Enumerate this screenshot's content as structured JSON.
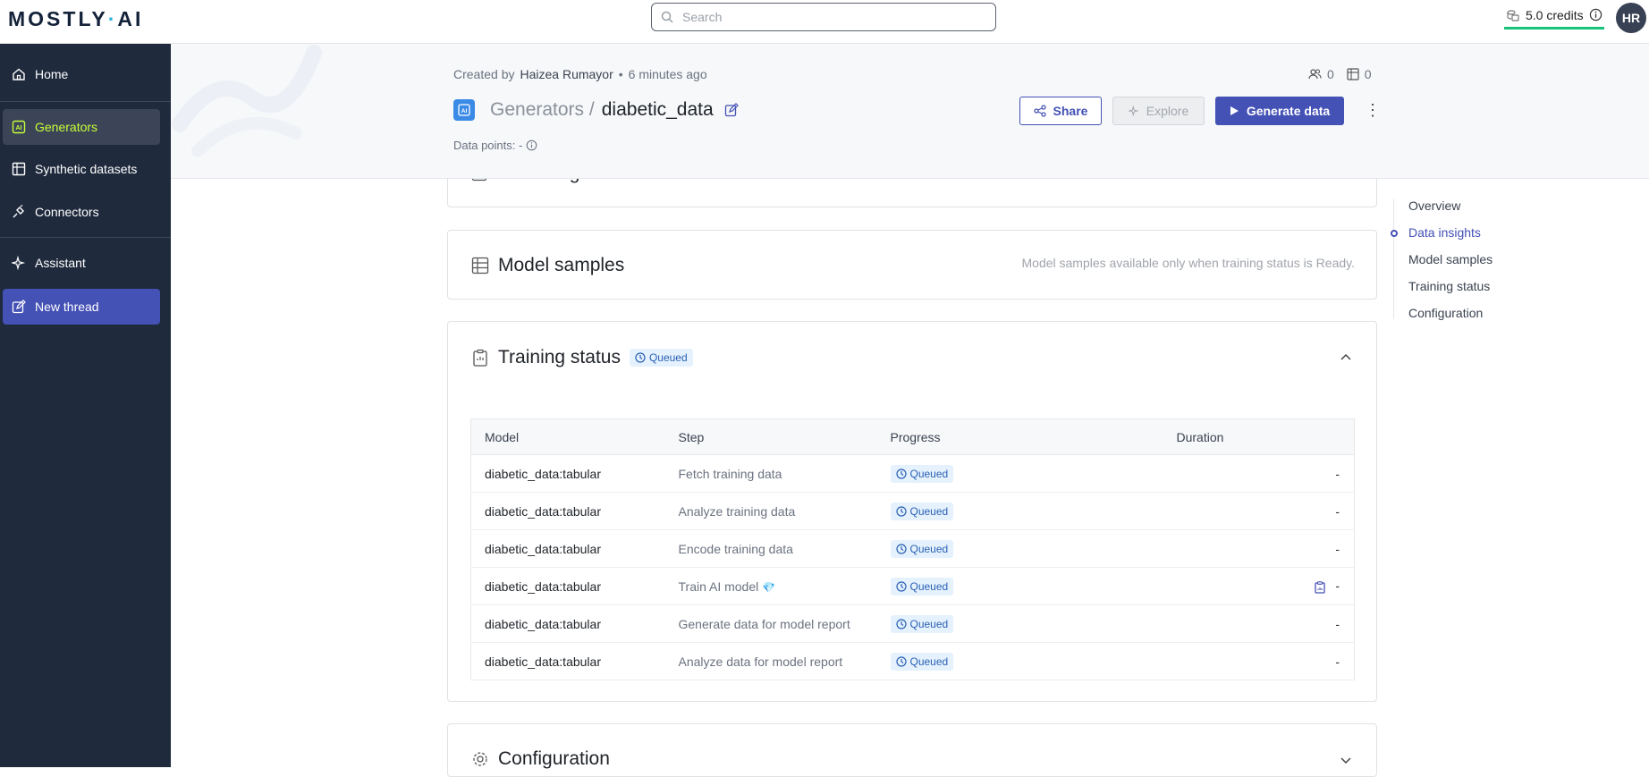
{
  "app": {
    "logo_left": "MOSTLY",
    "logo_dot": "·",
    "logo_right": "AI",
    "search_placeholder": "Search",
    "credits": "5.0 credits",
    "avatar_initials": "HR"
  },
  "sidebar": {
    "items": [
      {
        "label": "Home",
        "icon": "home-icon"
      },
      {
        "label": "Generators",
        "icon": "generator-icon",
        "active": true
      },
      {
        "label": "Synthetic datasets",
        "icon": "table-icon"
      },
      {
        "label": "Connectors",
        "icon": "plug-icon"
      },
      {
        "label": "Assistant",
        "icon": "sparkle-icon"
      },
      {
        "label": "New thread",
        "icon": "edit-icon",
        "primary": true
      }
    ]
  },
  "header": {
    "created_prefix": "Created by",
    "creator": "Haizea Rumayor",
    "separator": "•",
    "created_ago": "6 minutes ago",
    "shared_count": "0",
    "datasets_count": "0",
    "breadcrumb_parent": "Generators /",
    "title": "diabetic_data",
    "data_points": "Data points: -",
    "share_label": "Share",
    "explore_label": "Explore",
    "generate_label": "Generate data",
    "more": "⋮"
  },
  "sections": {
    "data_insights_title": "Data insights",
    "model_samples_title": "Model samples",
    "model_samples_hint": "Model samples available only when training status is Ready.",
    "training_status_title": "Training status",
    "training_status_badge": "Queued",
    "configuration_title": "Configuration"
  },
  "training_table": {
    "columns": [
      "Model",
      "Step",
      "Progress",
      "Duration"
    ],
    "rows": [
      {
        "model": "diabetic_data:tabular",
        "step": "Fetch training data",
        "progress": "Queued",
        "duration": "-"
      },
      {
        "model": "diabetic_data:tabular",
        "step": "Analyze training data",
        "progress": "Queued",
        "duration": "-"
      },
      {
        "model": "diabetic_data:tabular",
        "step": "Encode training data",
        "progress": "Queued",
        "duration": "-"
      },
      {
        "model": "diabetic_data:tabular",
        "step": "Train AI model",
        "progress": "Queued",
        "duration": "-",
        "gem": "💎"
      },
      {
        "model": "diabetic_data:tabular",
        "step": "Generate data for model report",
        "progress": "Queued",
        "duration": "-"
      },
      {
        "model": "diabetic_data:tabular",
        "step": "Analyze data for model report",
        "progress": "Queued",
        "duration": "-"
      }
    ]
  },
  "toc": {
    "items": [
      "Overview",
      "Data insights",
      "Model samples",
      "Training status",
      "Configuration"
    ],
    "active": "Data insights"
  },
  "colors": {
    "sidebar_bg": "#1f2a3d",
    "accent": "#4451b5",
    "active_text": "#c6ff3a",
    "credits_underline": "#17c27a"
  }
}
